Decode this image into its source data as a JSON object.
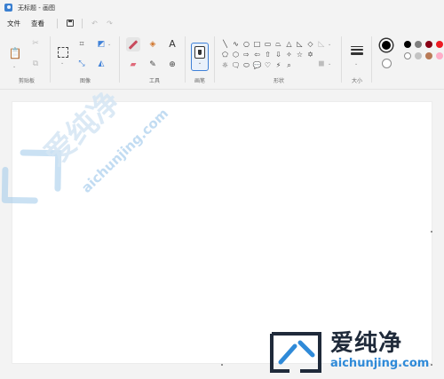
{
  "window": {
    "title": "无标题 - 画图"
  },
  "menu": {
    "file": "文件",
    "view": "查看"
  },
  "ribbon": {
    "groups": {
      "clipboard": "剪贴板",
      "image": "图像",
      "tools": "工具",
      "brushes": "画笔",
      "shapes": "形状",
      "size": "大小"
    },
    "text_tool_glyph": "A",
    "shapes": [
      "╲",
      "∿",
      "○",
      "□",
      "▭",
      "⏢",
      "△",
      "◺",
      "◇",
      "⬠",
      "⬡",
      "⇨",
      "⇦",
      "⇧",
      "⇩",
      "✧",
      "☆",
      "✡",
      "☼",
      "🗨",
      "⬭",
      "💬",
      "♡",
      "⚡",
      "⌕",
      "",
      ""
    ],
    "palette": {
      "primary": "#000000",
      "secondary": "#ffffff",
      "swatches_row1": [
        "#000000",
        "#7f7f7f",
        "#880015",
        "#ed1c24"
      ],
      "swatches_row2": [
        "#ffffff",
        "#c3c3c3",
        "#b97a57",
        "#ffaec9"
      ]
    }
  },
  "watermark": {
    "diagonal_cn": "爱纯净",
    "diagonal_url": "aichunjing.com",
    "brand_cn": "爱纯净",
    "brand_url": "aichunjing.com",
    "brand_dark": "#1f2a3a",
    "brand_blue": "#2f8ad8"
  }
}
